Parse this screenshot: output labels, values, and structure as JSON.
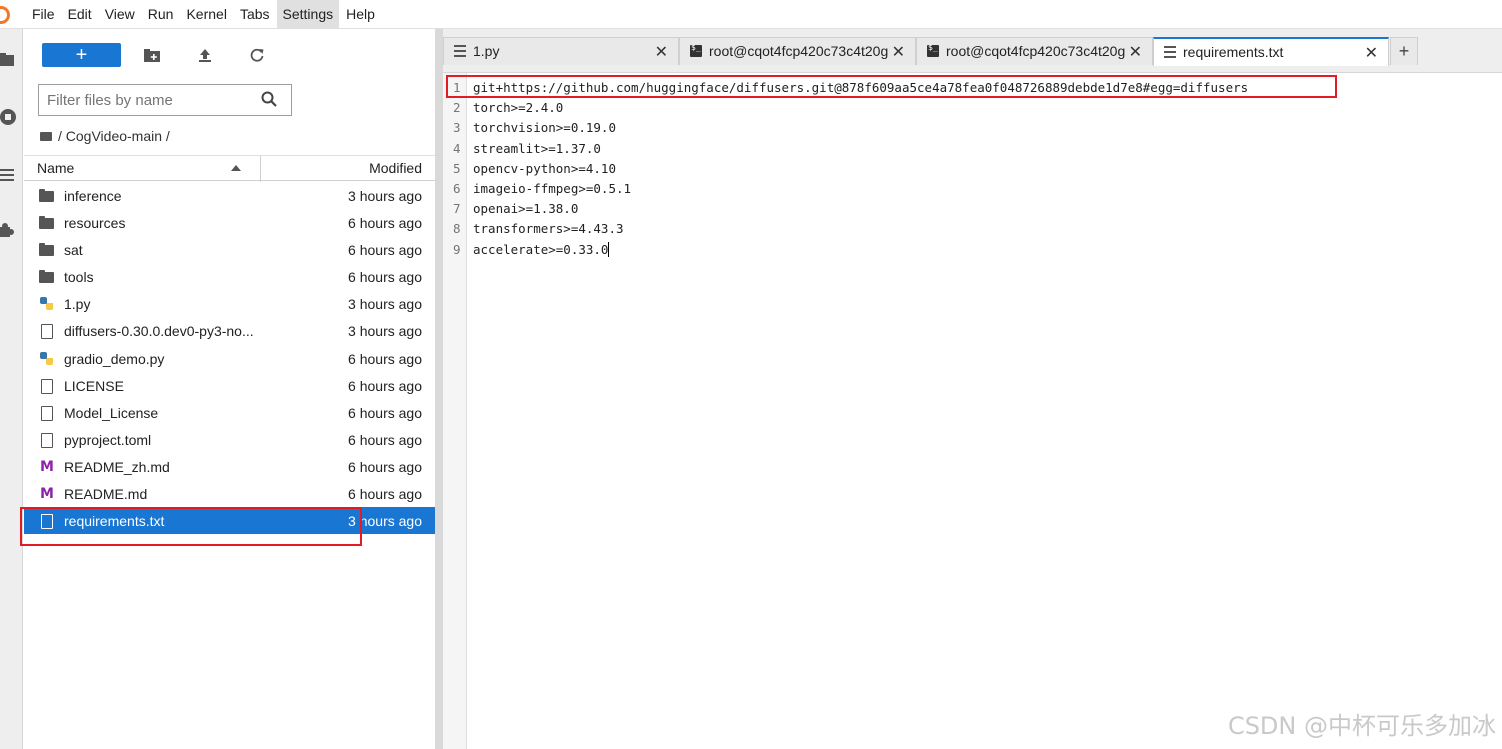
{
  "menubar": {
    "items": [
      "File",
      "Edit",
      "View",
      "Run",
      "Kernel",
      "Tabs",
      "Settings",
      "Help"
    ]
  },
  "filebrowser": {
    "new_label": "+",
    "filter_placeholder": "Filter files by name",
    "breadcrumb": "/ CogVideo-main /",
    "col_name": "Name",
    "col_modified": "Modified",
    "files": [
      {
        "name": "inference",
        "modified": "3 hours ago",
        "type": "folder"
      },
      {
        "name": "resources",
        "modified": "6 hours ago",
        "type": "folder"
      },
      {
        "name": "sat",
        "modified": "6 hours ago",
        "type": "folder"
      },
      {
        "name": "tools",
        "modified": "6 hours ago",
        "type": "folder"
      },
      {
        "name": "1.py",
        "modified": "3 hours ago",
        "type": "python"
      },
      {
        "name": "diffusers-0.30.0.dev0-py3-no...",
        "modified": "3 hours ago",
        "type": "file"
      },
      {
        "name": "gradio_demo.py",
        "modified": "6 hours ago",
        "type": "python"
      },
      {
        "name": "LICENSE",
        "modified": "6 hours ago",
        "type": "file"
      },
      {
        "name": "Model_License",
        "modified": "6 hours ago",
        "type": "file"
      },
      {
        "name": "pyproject.toml",
        "modified": "6 hours ago",
        "type": "file"
      },
      {
        "name": "README_zh.md",
        "modified": "6 hours ago",
        "type": "markdown"
      },
      {
        "name": "README.md",
        "modified": "6 hours ago",
        "type": "markdown"
      },
      {
        "name": "requirements.txt",
        "modified": "3 hours ago",
        "type": "file",
        "selected": true
      }
    ]
  },
  "tabs": [
    {
      "label": "1.py",
      "icon": "text-file-icon",
      "active": false
    },
    {
      "label": "root@cqot4fcp420c73c4t20g",
      "icon": "terminal-icon",
      "active": false
    },
    {
      "label": "root@cqot4fcp420c73c4t20g",
      "icon": "terminal-icon",
      "active": false
    },
    {
      "label": "requirements.txt",
      "icon": "text-file-icon",
      "active": true
    }
  ],
  "add_tab_label": "+",
  "close_glyph": "✕",
  "editor": {
    "lines": [
      "git+https://github.com/huggingface/diffusers.git@878f609aa5ce4a78fea0f048726889debde1d7e8#egg=diffusers",
      "torch>=2.4.0",
      "torchvision>=0.19.0",
      "streamlit>=1.37.0",
      "opencv-python>=4.10",
      "imageio-ffmpeg>=0.5.1",
      "openai>=1.38.0",
      "transformers>=4.43.3",
      "accelerate>=0.33.0"
    ]
  },
  "watermark": "CSDN @中杯可乐多加冰",
  "colors": {
    "accent": "#1976d2",
    "highlight": "#e31b23",
    "logo": "#f37726"
  }
}
